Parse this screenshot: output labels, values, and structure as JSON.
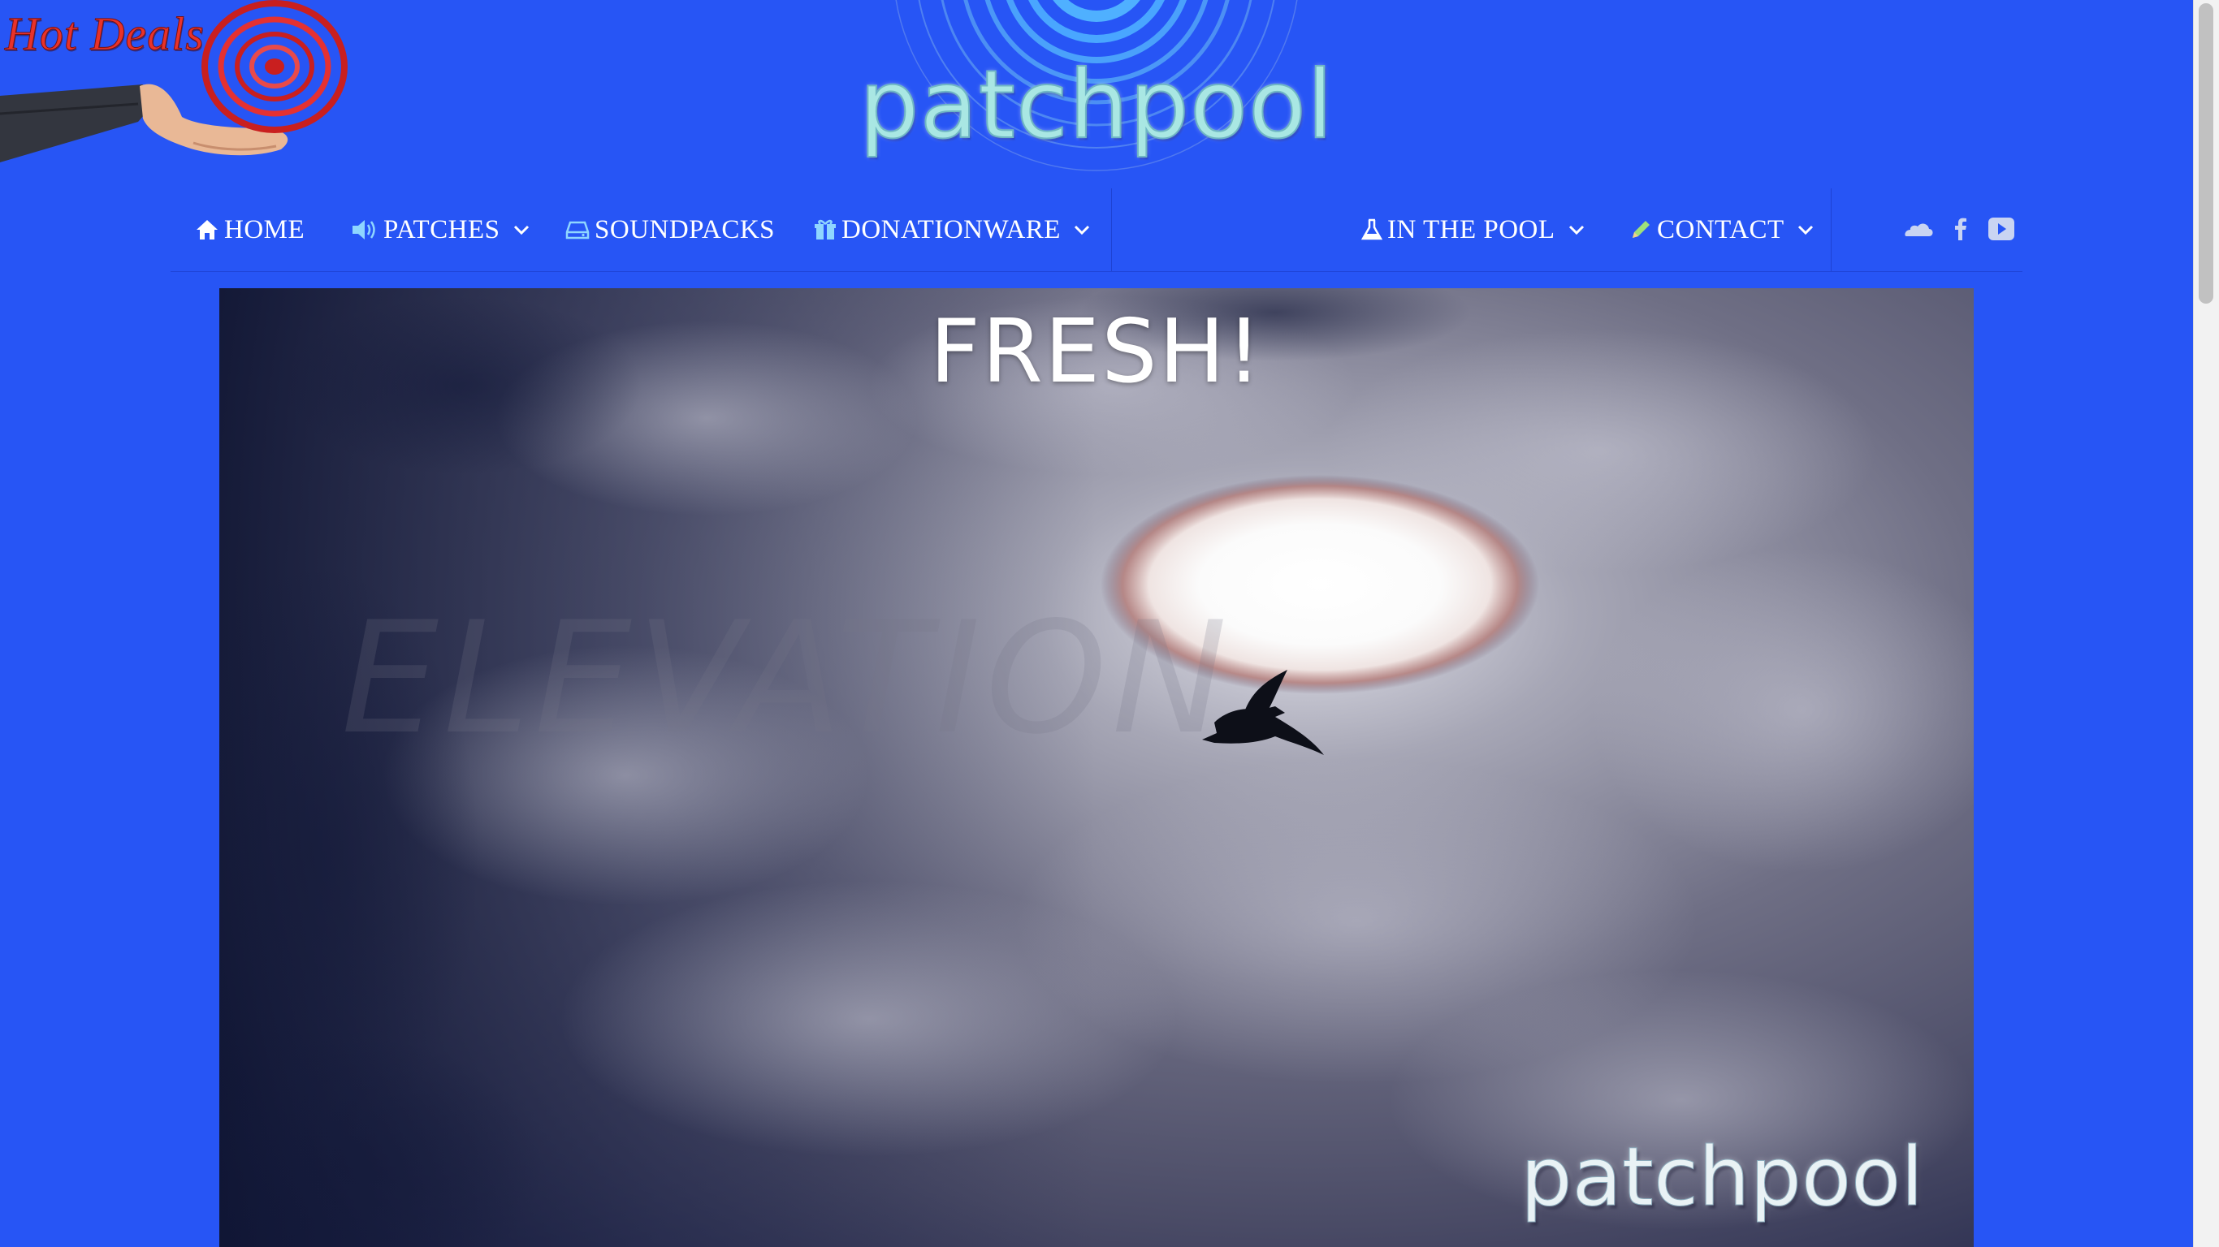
{
  "promo": {
    "label": "Hot Deals",
    "icon": "hand-holding-target-icon"
  },
  "site": {
    "brand": "patchpool"
  },
  "nav": {
    "items": [
      {
        "label": "HOME",
        "icon": "home-icon",
        "has_dropdown": false
      },
      {
        "label": "PATCHES",
        "icon": "speaker-icon",
        "has_dropdown": true
      },
      {
        "label": "SOUNDPACKS",
        "icon": "drive-icon",
        "has_dropdown": false
      },
      {
        "label": "DONATIONWARE",
        "icon": "gift-icon",
        "has_dropdown": true
      },
      {
        "label": "IN THE POOL",
        "icon": "flask-icon",
        "has_dropdown": true
      },
      {
        "label": "CONTACT",
        "icon": "pencil-icon",
        "has_dropdown": true
      }
    ],
    "social": [
      "soundcloud-icon",
      "facebook-icon",
      "youtube-icon"
    ]
  },
  "hero": {
    "title": "FRESH!",
    "watermark": "ELEVATION",
    "brand": "patchpool"
  },
  "colors": {
    "background": "#2755f5",
    "nav_text": "#ffffff",
    "nav_icon": "#8fd6ff",
    "logo_text": "#a9e7e3",
    "promo_text": "#e8322a"
  }
}
